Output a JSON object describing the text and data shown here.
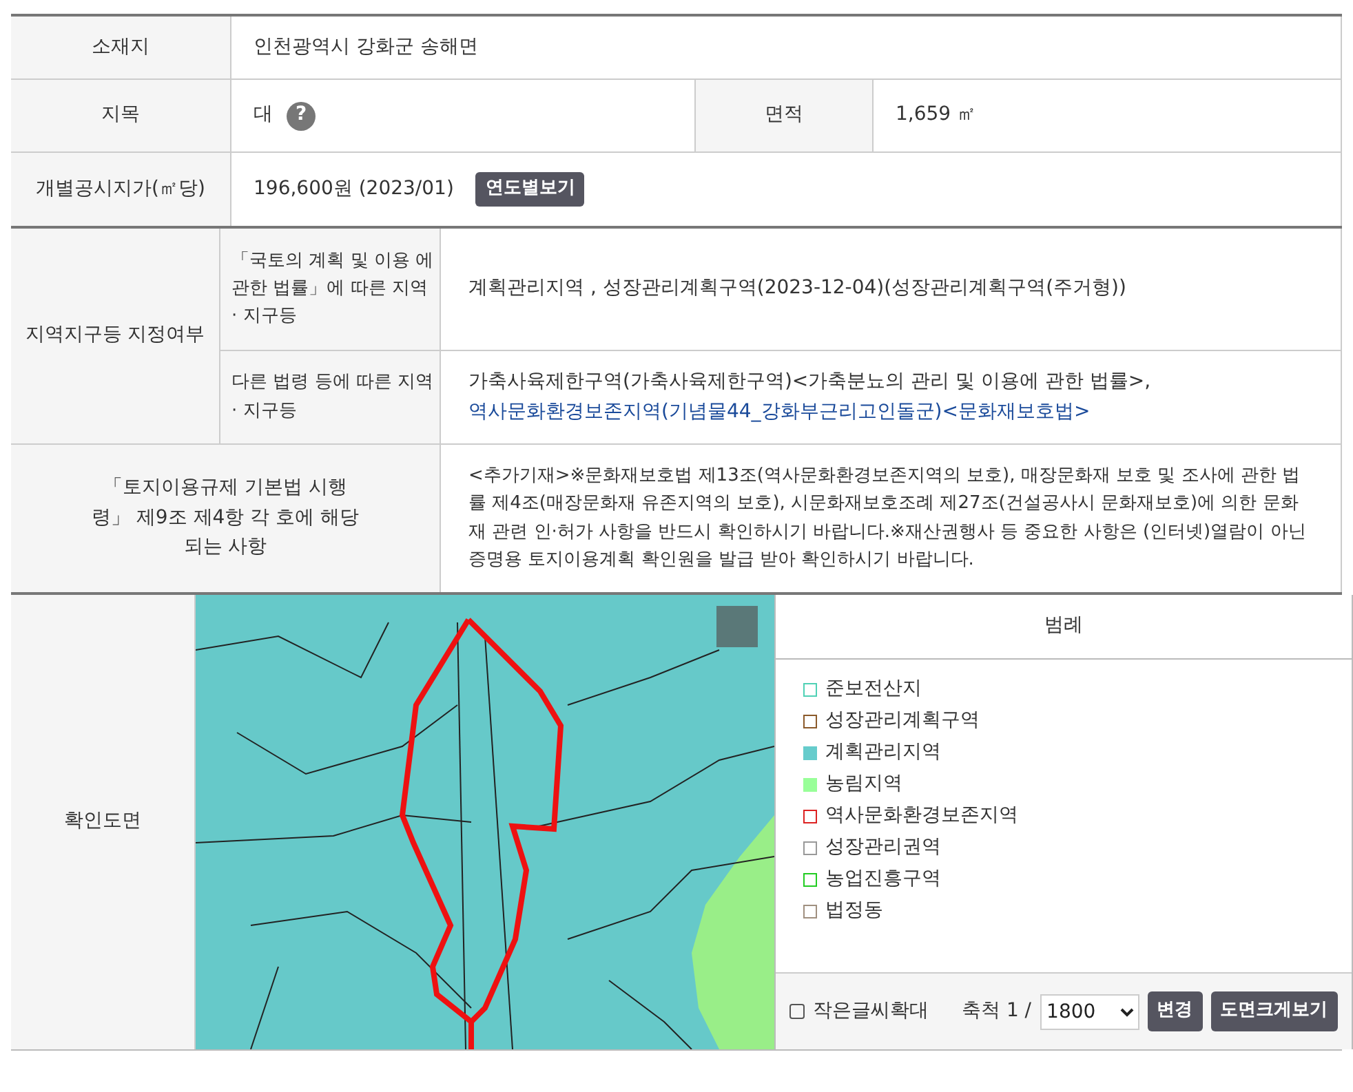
{
  "location": {
    "label": "소재지",
    "value": "인천광역시 강화군 송해면"
  },
  "land_category": {
    "label": "지목",
    "value": "대",
    "help_icon": "?"
  },
  "area": {
    "label": "면적",
    "value": "1,659 ㎡"
  },
  "official_price": {
    "label": "개별공시지가(㎡당)",
    "value": "196,600원 (2023/01)",
    "button": "연도별보기"
  },
  "zoning": {
    "label": "지역지구등 지정여부",
    "groups": [
      {
        "label": "「국토의 계획 및 이용 에 관한 법률」에 따른 지역 · 지구등",
        "segments": [
          {
            "text": "계획관리지역 , 성장관리계획구역(2023-12-04)(성장관리계획구역(주거형))",
            "link": false
          }
        ]
      },
      {
        "label": "다른 법령 등에 따른 지역 · 지구등",
        "segments": [
          {
            "text": "가축사육제한구역(가축사육제한구역)<가축분뇨의 관리 및 이용에 관한 법률>, ",
            "link": false
          },
          {
            "text": "역사문화환경보존지역(기념물44_강화부근리고인돌군)<문화재보호법>",
            "link": true
          }
        ]
      }
    ]
  },
  "additional": {
    "label": "「토지이용규제 기본법 시행령」 제9조 제4항 각 호에 해당되는 사항",
    "text": "<추가기재>※문화재보호법 제13조(역사문화환경보존지역의 보호), 매장문화재 보호 및 조사에 관한 법률 제4조(매장문화재 유존지역의 보호), 시문화재보호조례 제27조(건설공사시 문화재보호)에 의한 문화재 관련 인·허가 사항을 반드시 확인하시기 바랍니다.※재산권행사 등 중요한 사항은 (인터넷)열람이 아닌 증명용 토지이용계획 확인원을 발급 받아 확인하시기 바랍니다."
  },
  "map": {
    "label": "확인도면",
    "legend_title": "범례",
    "legend": [
      {
        "label": "준보전산지",
        "color": "#4fd1b5",
        "filled": false
      },
      {
        "label": "성장관리계획구역",
        "color": "#8b5a2b",
        "filled": false
      },
      {
        "label": "계획관리지역",
        "color": "#66cccc",
        "filled": true
      },
      {
        "label": "농림지역",
        "color": "#99ff99",
        "filled": true
      },
      {
        "label": "역사문화환경보존지역",
        "color": "#dd2222",
        "filled": false
      },
      {
        "label": "성장관리권역",
        "color": "#999999",
        "filled": false
      },
      {
        "label": "농업진흥구역",
        "color": "#22cc22",
        "filled": false
      },
      {
        "label": "법정동",
        "color": "#a09080",
        "filled": false
      }
    ],
    "enlarge": {
      "label": "작은글씨확대",
      "checked": false
    },
    "scale_label": "축척 1 /",
    "scale": "1800",
    "change_button": "변경",
    "large_button": "도면크게보기"
  }
}
